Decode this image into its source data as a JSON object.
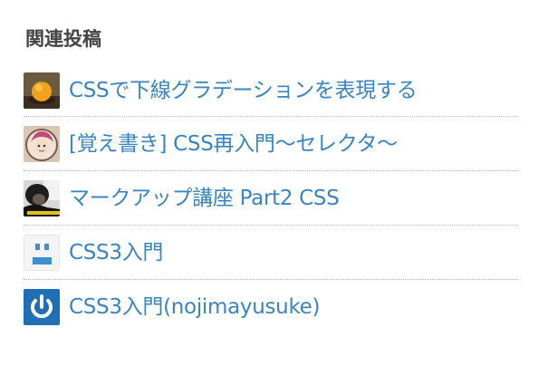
{
  "widget": {
    "heading": "関連投稿"
  },
  "posts": [
    {
      "title": "CSSで下線グラデーションを表現する",
      "thumbnail_icon": "orange-fruit-photo"
    },
    {
      "title": "[覚え書き] CSS再入門〜セレクタ〜",
      "thumbnail_icon": "anime-character-photo"
    },
    {
      "title": "マークアップ講座 Part2 CSS",
      "thumbnail_icon": "person-portrait-photo"
    },
    {
      "title": "CSS3入門",
      "thumbnail_icon": "default-face-icon"
    },
    {
      "title": "CSS3入門(nojimayusuke)",
      "thumbnail_icon": "power-button-icon"
    }
  ],
  "colors": {
    "link": "#3a84c0",
    "heading": "#444444",
    "divider": "#b8b8b8",
    "power_icon_bg": "#1f6fb5"
  }
}
